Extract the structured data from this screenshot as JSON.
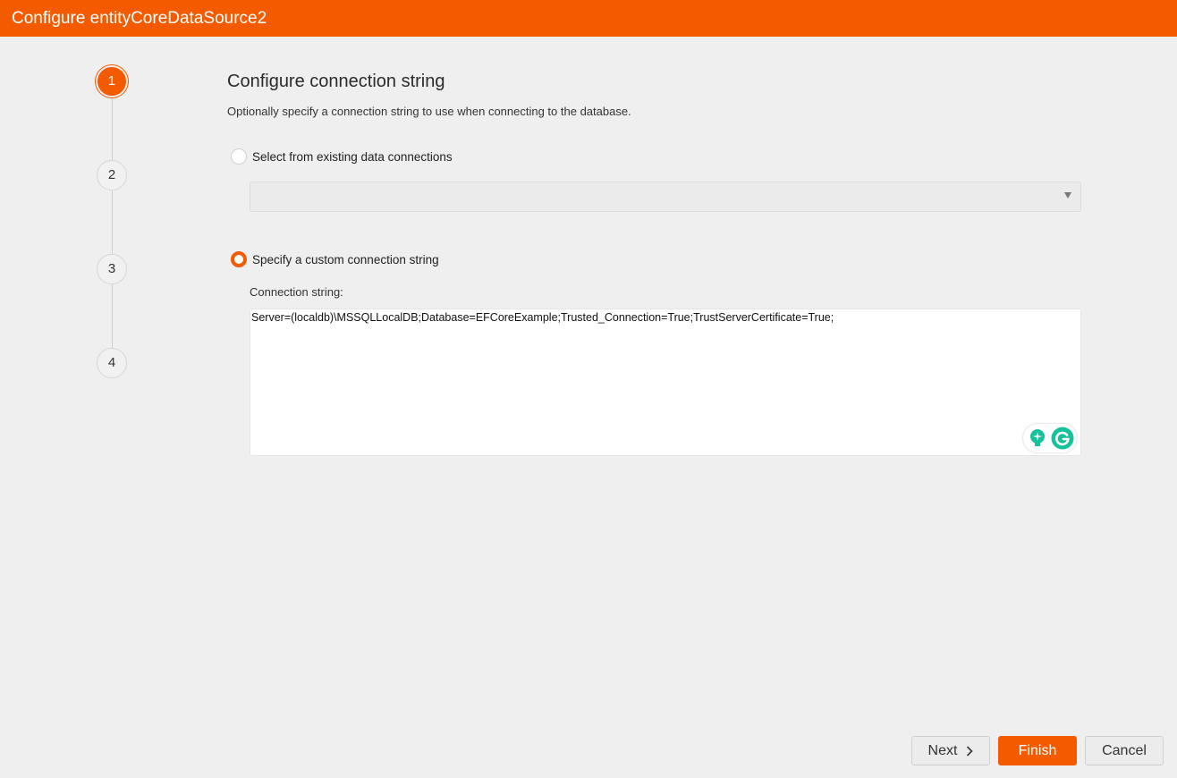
{
  "window": {
    "title": "Configure entityCoreDataSource2"
  },
  "steps": [
    {
      "label": "1",
      "active": true
    },
    {
      "label": "2",
      "active": false
    },
    {
      "label": "3",
      "active": false
    },
    {
      "label": "4",
      "active": false
    }
  ],
  "page": {
    "heading": "Configure connection string",
    "description": "Optionally specify a connection string to use when connecting to the database."
  },
  "options": {
    "existing": {
      "label": "Select from existing data connections",
      "selected": false,
      "dropdown_value": ""
    },
    "custom": {
      "label": "Specify a custom connection string",
      "selected": true
    }
  },
  "connection": {
    "label": "Connection string:",
    "value": "Server=(localdb)\\MSSQLLocalDB;Database=EFCoreExample;Trusted_Connection=True;TrustServerCertificate=True;"
  },
  "buttons": {
    "next": "Next",
    "finish": "Finish",
    "cancel": "Cancel"
  },
  "colors": {
    "accent": "#f45b00",
    "grammarly": "#15c39a"
  }
}
